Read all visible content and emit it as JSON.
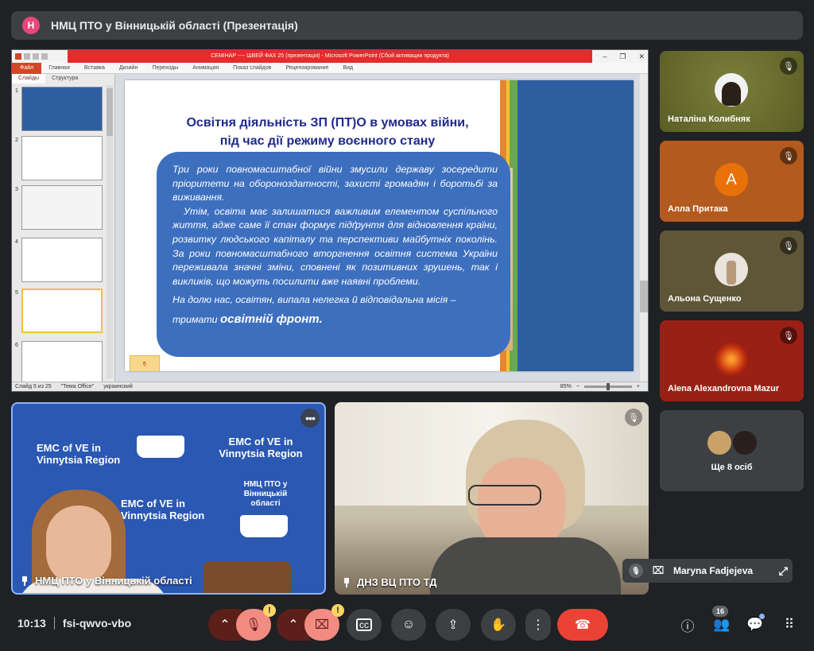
{
  "meeting": {
    "presenter_initial": "Н",
    "presentation_title": "НМЦ ПТО у Вінницькій області (Презентація)"
  },
  "ppt": {
    "window_title": "СЕМІНАР ---- ШВЕЙ ФАХ 25 (презентація) - Microsoft PowerPoint (Сбой активации продукта)",
    "menu": [
      "Файл",
      "Главная",
      "Вставка",
      "Дизайн",
      "Переходы",
      "Анимация",
      "Показ слайдов",
      "Рецензирование",
      "Вид"
    ],
    "tabs": [
      "Слайды",
      "Структура"
    ],
    "thumb_numbers": [
      "1",
      "2",
      "3",
      "4",
      "5",
      "6"
    ],
    "status_slide": "Слайд 5 из 25",
    "status_theme": "\"Тема Office\"",
    "status_lang": "украинский",
    "zoom": "85%",
    "slide": {
      "heading_line1": "Освітня діяльність ЗП (ПТ)О в умовах війни,",
      "heading_line2": "під час дії режиму воєнного стану",
      "para1": "Три роки повномасштабної війни змусили державу зосередити пріоритети на обороноздатності, захисті громадян і боротьбі за виживання.",
      "para2": "Утім, освіта має залишатися важливим елементом суспільного життя, адже саме її стан формує підґрунтя для відновлення країни, розвитку людського капіталу та перспективи майбутніх поколінь. За роки повномасштабного вторгнення освітня система України переживала значні зміни, сповнені як позитивних зрушень, так і викликів, що можуть посилити вже наявні проблеми.",
      "para3_a": "На долю нас, освітян, випала нелегка й відповідальна місія –",
      "para3_b": "тримати",
      "para3_c": "освітній фронт.",
      "sticky": "5"
    }
  },
  "participants": [
    {
      "name": "Наталіна Колибняк"
    },
    {
      "name": "Алла Притака",
      "initial": "A"
    },
    {
      "name": "Альона Сущенко"
    },
    {
      "name": "Alena Alexandrovna Mazur"
    }
  ],
  "more_people": "Ще 8 осіб",
  "video_tiles": [
    {
      "name": "НМЦ ПТО у Вінницькій області",
      "banner_a": "EMC of VE in Vinnytsia Region",
      "banner_b": "EMC of VE in Vinnytsia Region",
      "banner_c": "НМЦ ПТО у Вінницькій області",
      "banner_d": "EMC of VE in Vinnytsia Region"
    },
    {
      "name": "ДНЗ ВЦ ПТО ТД"
    }
  ],
  "self_view": {
    "name": "Maryna Fadjejeva"
  },
  "bottom": {
    "time": "10:13",
    "meeting_code": "fsi-qwvo-vbo",
    "participants_count": "16"
  },
  "colors": {
    "end_call": "#ea4335",
    "mic_off": "#f28b82",
    "slide_box": "#3d6fbf",
    "slide_heading": "#1f2a8a"
  }
}
